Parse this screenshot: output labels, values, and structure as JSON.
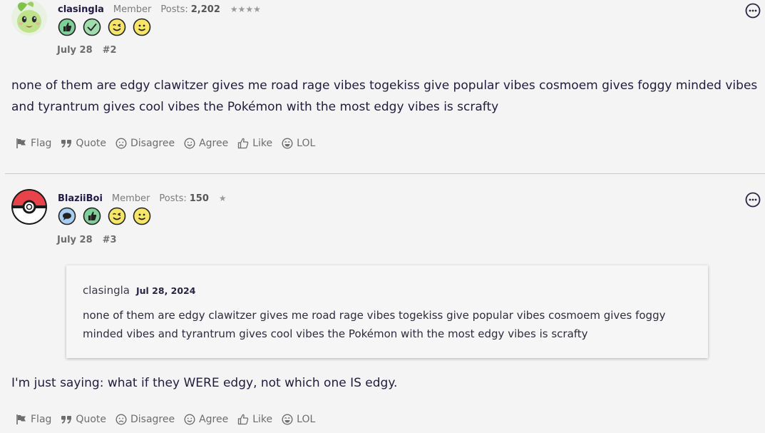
{
  "posts": [
    {
      "username": "clasingla",
      "role": "Member",
      "posts_label": "Posts:",
      "posts_count": "2,202",
      "stars": "★★★★",
      "date": "July 28",
      "number": "#2",
      "badges": [
        "thumbs-up-badge",
        "check-badge",
        "wink-badge",
        "smile-badge"
      ],
      "body": "none of them are edgy clawitzer gives me road rage vibes togekiss give popular vibes cosmoem gives foggy minded vibes and tyrantrum gives cool vibes the Pokémon with the most edgy vibes is scrafty",
      "actions": [
        "Flag",
        "Quote",
        "Disagree",
        "Agree",
        "Like",
        "LOL"
      ]
    },
    {
      "username": "BlaziiBoi",
      "role": "Member",
      "posts_label": "Posts:",
      "posts_count": "150",
      "stars": "★",
      "date": "July 28",
      "number": "#3",
      "badges": [
        "comment-badge",
        "thumbs-up-badge",
        "wink-badge",
        "smile-badge"
      ],
      "quote": {
        "author": "clasingla",
        "date": "Jul 28, 2024",
        "text": "none of them are edgy clawitzer gives me road rage vibes togekiss give popular vibes cosmoem gives foggy minded vibes and tyrantrum gives cool vibes the Pokémon with the most edgy vibes is scrafty"
      },
      "body": "I'm just saying: what if they WERE edgy, not which one IS edgy.",
      "actions": [
        "Flag",
        "Quote",
        "Disagree",
        "Agree",
        "Like",
        "LOL"
      ]
    }
  ],
  "icons": {
    "flag": "flag-icon",
    "quote": "quote-icon",
    "disagree": "frown-icon",
    "agree": "smile-icon",
    "like": "thumbs-up-icon",
    "lol": "laugh-icon",
    "more": "more-options-icon"
  },
  "colors": {
    "background": "#f4f4f4",
    "text": "#1f1c3d",
    "badge_green": "#7fcf9a",
    "badge_yellow": "#f7e56a",
    "badge_blue": "#a9cdf0",
    "pokeball_red": "#e8434a"
  }
}
